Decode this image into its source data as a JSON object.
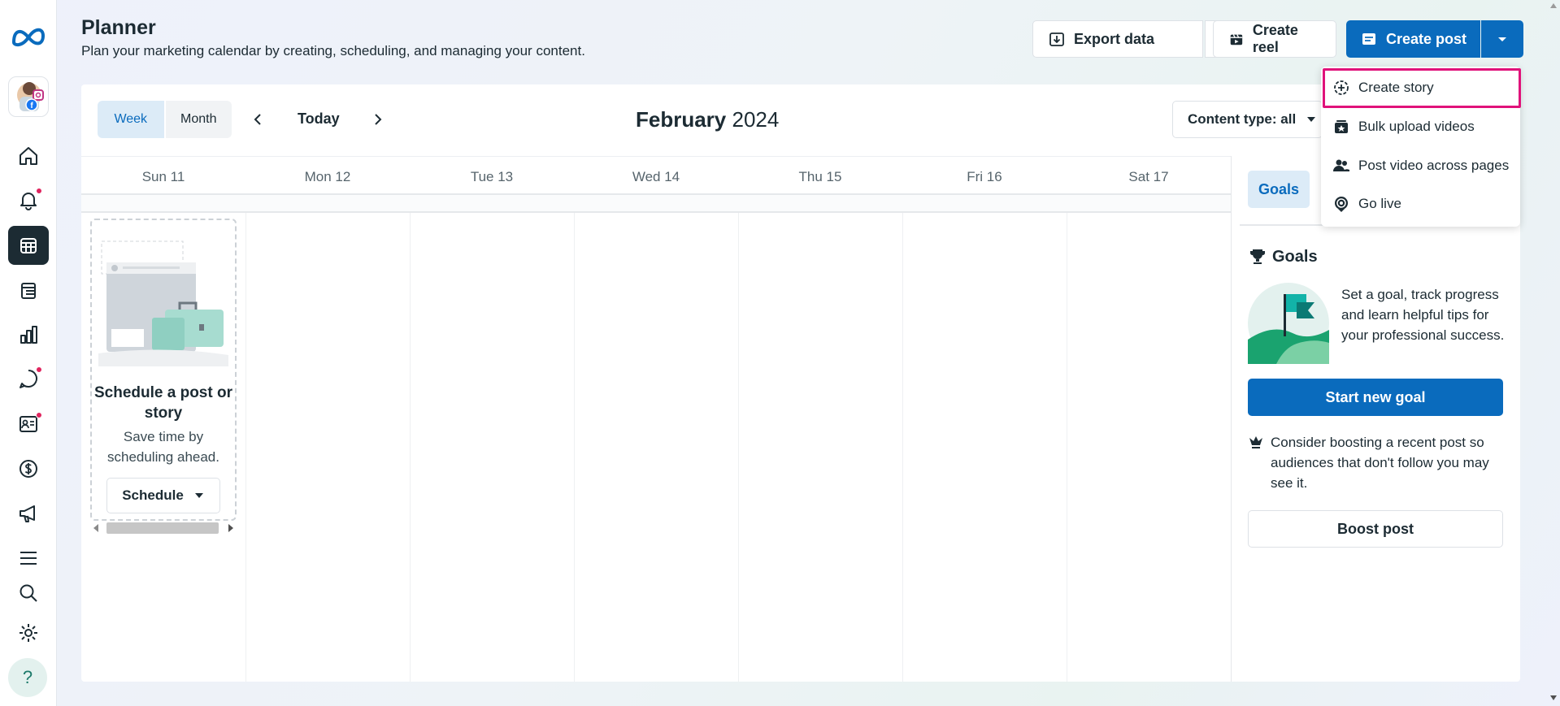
{
  "header": {
    "title": "Planner",
    "subtitle": "Plan your marketing calendar by creating, scheduling, and managing your content.",
    "export_label": "Export data",
    "create_reel_label": "Create reel",
    "create_post_label": "Create post"
  },
  "dropdown": {
    "items": [
      {
        "label": "Create story",
        "icon": "plus-circle-icon"
      },
      {
        "label": "Bulk upload videos",
        "icon": "video-stack-icon"
      },
      {
        "label": "Post video across pages",
        "icon": "people-icon"
      },
      {
        "label": "Go live",
        "icon": "live-icon"
      }
    ]
  },
  "calendar": {
    "view_week": "Week",
    "view_month": "Month",
    "today_label": "Today",
    "month_name": "February",
    "year": "2024",
    "content_type_label": "Content type: all",
    "days": [
      "Sun 11",
      "Mon 12",
      "Tue 13",
      "Wed 14",
      "Thu 15",
      "Fri 16",
      "Sat 17"
    ]
  },
  "schedule_card": {
    "title": "Schedule a post or story",
    "subtitle": "Save time by scheduling ahead.",
    "button_label": "Schedule"
  },
  "sidebar": {
    "tab_label": "Goals",
    "goals_heading": "Goals",
    "goals_text": "Set a goal, track progress and learn helpful tips for your professional success.",
    "start_goal_label": "Start new goal",
    "boost_text": "Consider boosting a recent post so audiences that don't follow you may see it.",
    "boost_button_label": "Boost post"
  },
  "nav": {
    "icons": [
      "home-icon",
      "notifications-icon",
      "planner-icon",
      "content-icon",
      "insights-icon",
      "inbox-icon",
      "contacts-icon",
      "monetization-icon",
      "ads-icon",
      "menu-icon",
      "search-icon",
      "settings-icon",
      "help-icon"
    ],
    "help_glyph": "?"
  },
  "colors": {
    "accent": "#0a6bbd",
    "highlight": "#e0127a",
    "notification_dot": "#e0245e",
    "active_nav": "#1c2b33"
  }
}
